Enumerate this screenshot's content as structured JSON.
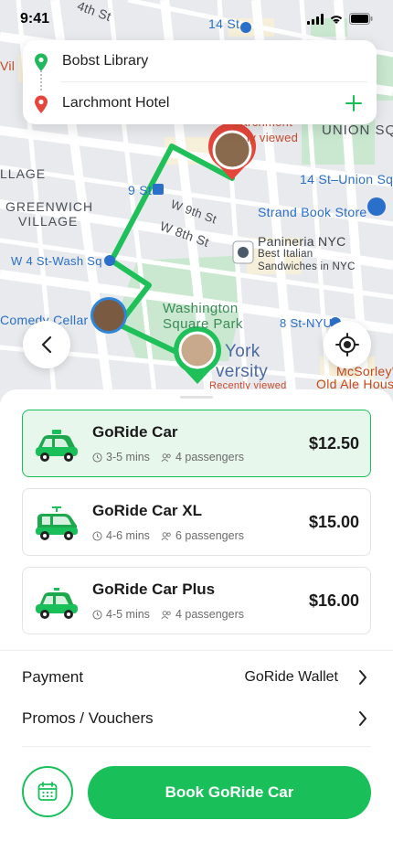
{
  "status": {
    "time": "9:41"
  },
  "route": {
    "pickup": "Bobst Library",
    "dropoff": "Larchmont Hotel"
  },
  "map": {
    "labels": {
      "street_4th": "4th St",
      "street_14": "14 St",
      "union_square": "UNION SQUARE",
      "village": "LLAGE",
      "greenwich": "GREENWICH",
      "village2": "VILLAGE",
      "union_st": "14 St–Union Sq",
      "nine_st": "9 St",
      "w9th": "W 9th St",
      "w8th": "W 8th St",
      "strand": "Strand Book Store",
      "panineria_name": "Panineria NYC",
      "panineria_desc1": "Best Italian",
      "panineria_desc2": "Sandwiches in NYC",
      "w4": "W 4 St-Wash Sq",
      "washington1": "Washington",
      "washington2": "Square Park",
      "comedy": "Comedy Cellar",
      "eight_nyu": "8 St-NYU",
      "ny_univ1": "York",
      "ny_univ2": "versity",
      "mcsorley1": "McSorley's",
      "mcsorley2": "Old Ale House",
      "larchmont_bg": "Larchmont",
      "recent1": "ly viewed",
      "recent2": "Recently viewed",
      "vil": "Vil"
    }
  },
  "rides": [
    {
      "name": "GoRide Car",
      "time": "3-5 mins",
      "passengers": "4 passengers",
      "price": "$12.50",
      "selected": true
    },
    {
      "name": "GoRide Car XL",
      "time": "4-6 mins",
      "passengers": "6 passengers",
      "price": "$15.00",
      "selected": false
    },
    {
      "name": "GoRide Car Plus",
      "time": "4-5 mins",
      "passengers": "4 passengers",
      "price": "$16.00",
      "selected": false
    }
  ],
  "payment": {
    "label": "Payment",
    "value": "GoRide Wallet"
  },
  "promos": {
    "label": "Promos / Vouchers"
  },
  "book": {
    "label": "Book GoRide Car"
  },
  "colors": {
    "accent": "#19c05a",
    "accent_light": "#e8f7ec",
    "pickup_pin": "#1fb85a",
    "dropoff_pin": "#e5453a",
    "route": "#1fc05a"
  }
}
